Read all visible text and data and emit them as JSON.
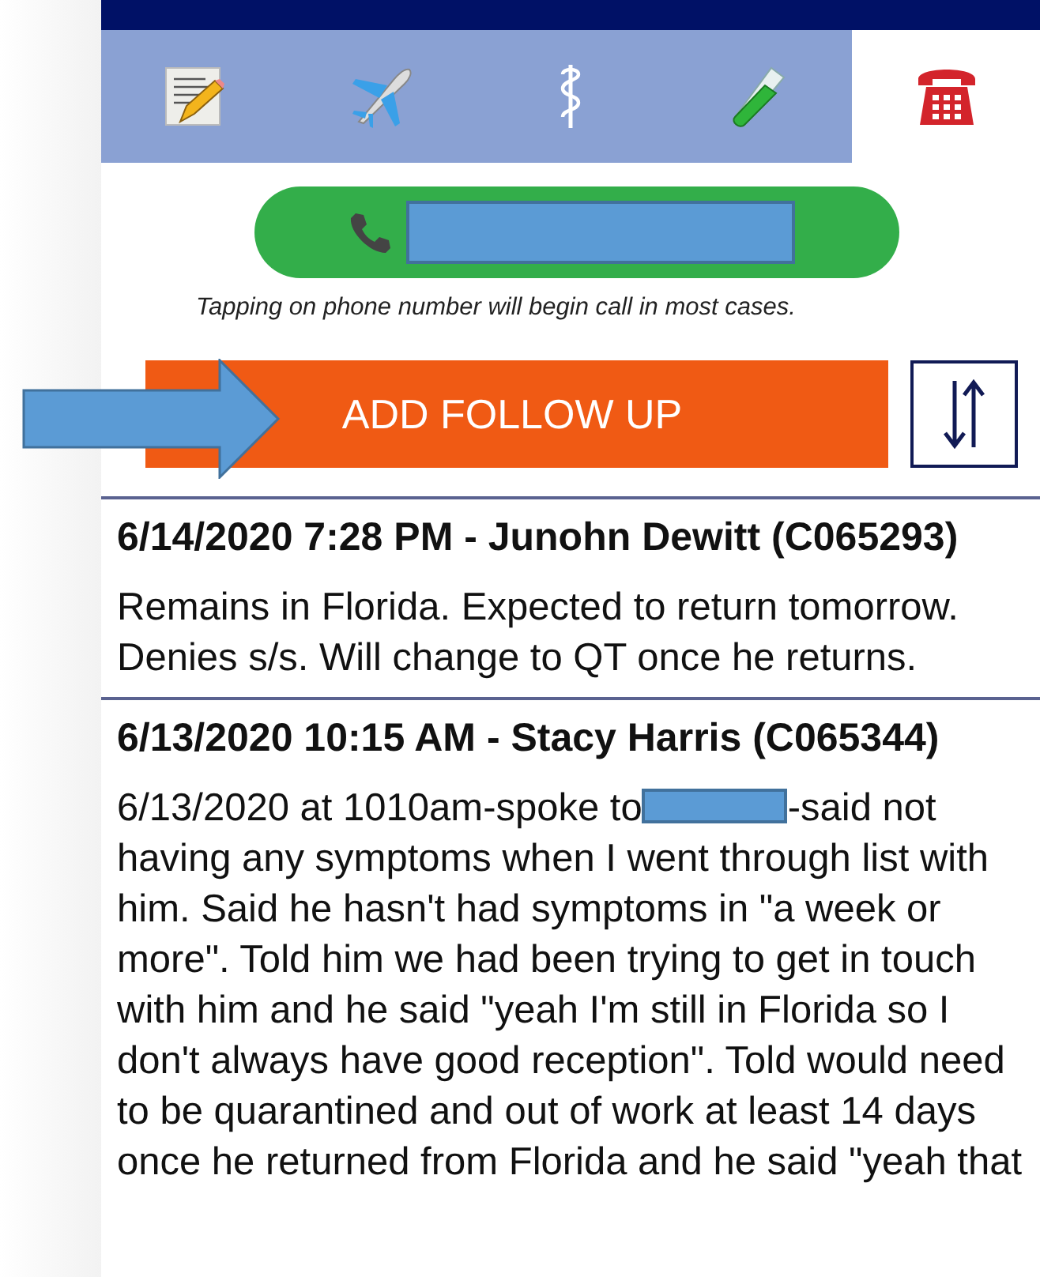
{
  "tabs": [
    {
      "selected": false
    },
    {
      "selected": false
    },
    {
      "selected": false
    },
    {
      "selected": false
    },
    {
      "selected": true
    }
  ],
  "call_button": {
    "number_redacted": true
  },
  "hint": "Tapping on phone number will begin call in most cases.",
  "add_button": "ADD FOLLOW UP",
  "notes": [
    {
      "header": "6/14/2020 7:28 PM - Junohn Dewitt (C065293)",
      "body_before": "Remains in Florida. Expected to return tomorrow. Denies s/s. Will change to QT once he returns."
    },
    {
      "header": "6/13/2020 10:15 AM - Stacy Harris (C065344)",
      "body_before": "6/13/2020 at 1010am-spoke to",
      "redacted": true,
      "body_after": "-said not having any symptoms when I went through list with him. Said he hasn't had symptoms in \"a week or more\". Told him we had been trying to get in touch with him and he said \"yeah I'm still in Florida so I don't always have good reception\". Told would need to be quarantined and out of work at least 14 days once he returned from Florida and he said \"yeah that"
    }
  ]
}
